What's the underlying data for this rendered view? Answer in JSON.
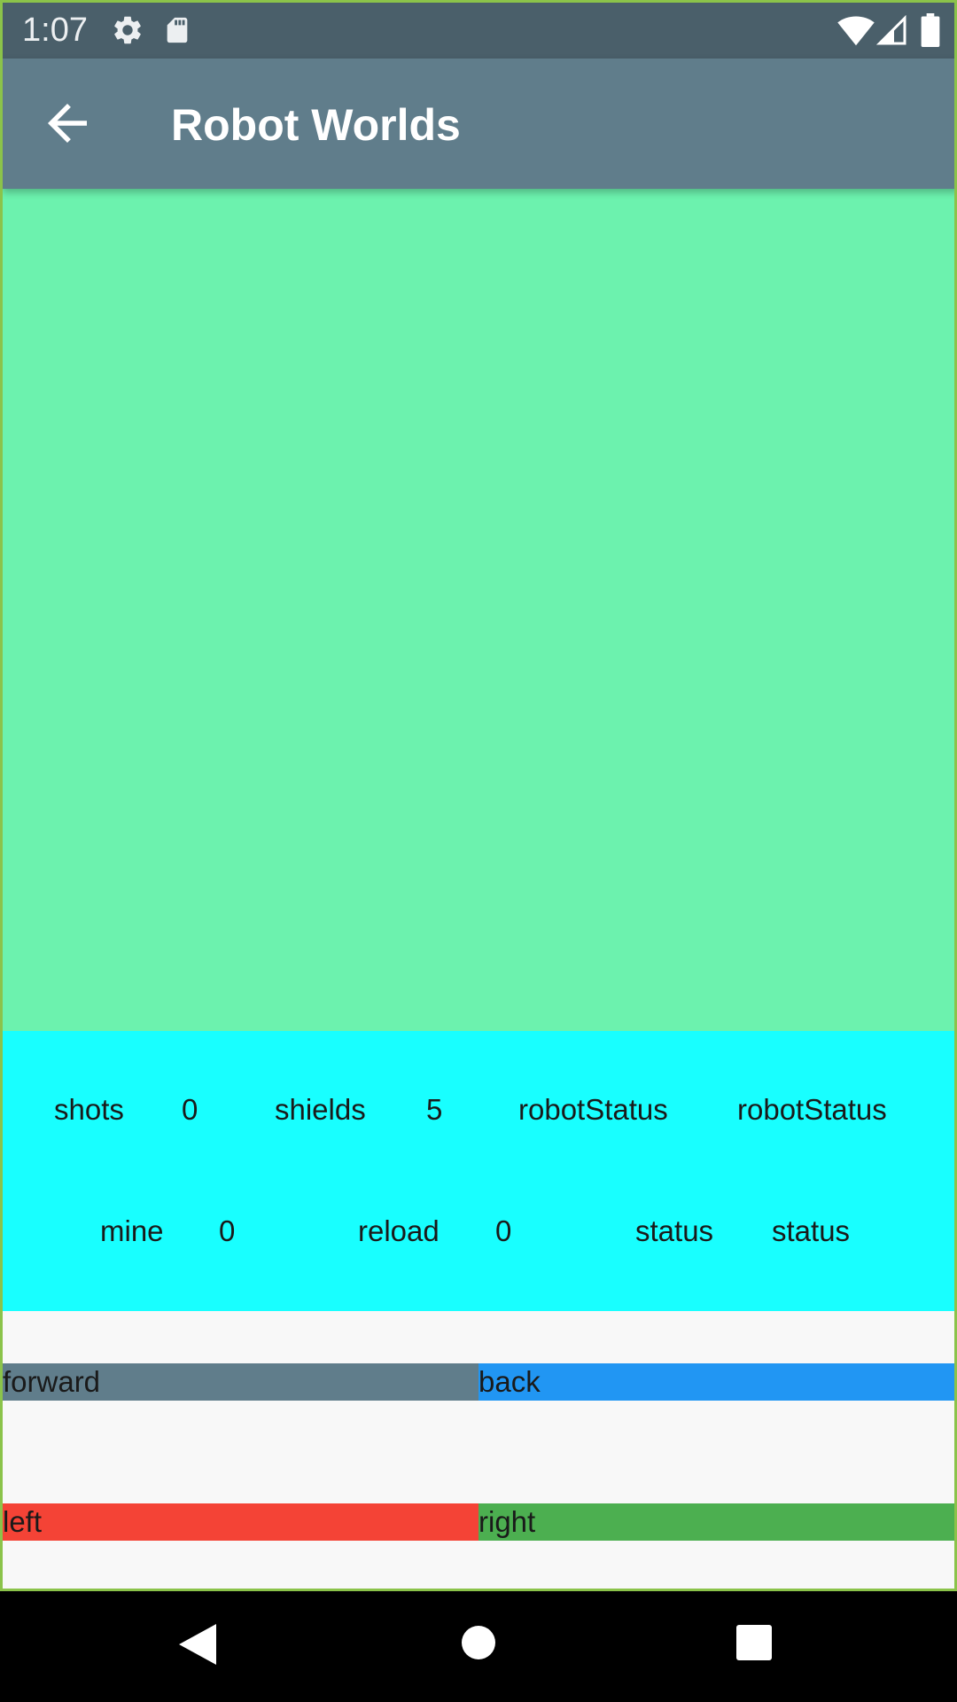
{
  "status_bar": {
    "time": "1:07",
    "icons": [
      "settings-icon",
      "sd-card-icon",
      "wifi-icon",
      "signal-icon",
      "battery-icon"
    ]
  },
  "app_bar": {
    "back_icon": "arrow-back-icon",
    "title": "Robot Worlds"
  },
  "stats": {
    "row1": {
      "shots_label": "shots",
      "shots_value": "0",
      "shields_label": "shields",
      "shields_value": "5",
      "robot_status_label": "robotStatus",
      "robot_status_value": "robotStatus"
    },
    "row2": {
      "mine_label": "mine",
      "mine_value": "0",
      "reload_label": "reload",
      "reload_value": "0",
      "status_label": "status",
      "status_value": "status"
    }
  },
  "controls": {
    "forward": "forward",
    "back": "back",
    "left": "left",
    "right": "right"
  },
  "colors": {
    "status_bar": "#4A5F6A",
    "app_bar": "#607D8B",
    "world": "#6CF2AE",
    "stats_panel": "#18FFFF",
    "forward_button": "#607D8B",
    "back_button": "#2196F3",
    "left_button": "#F44336",
    "right_button": "#4CAF50"
  },
  "nav_bar": {
    "icons": [
      "back-triangle-icon",
      "home-circle-icon",
      "recents-square-icon"
    ]
  }
}
